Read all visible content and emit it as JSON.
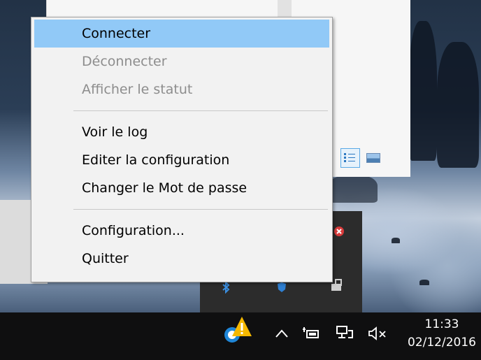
{
  "context_menu": {
    "groups": [
      [
        {
          "label": "Connecter",
          "state": "highlighted"
        },
        {
          "label": "Déconnecter",
          "state": "disabled"
        },
        {
          "label": "Afficher le statut",
          "state": "disabled"
        }
      ],
      [
        {
          "label": "Voir le log",
          "state": "enabled"
        },
        {
          "label": "Editer la configuration",
          "state": "enabled"
        },
        {
          "label": "Changer le Mot de passe",
          "state": "enabled"
        }
      ],
      [
        {
          "label": "Configuration...",
          "state": "enabled"
        },
        {
          "label": "Quitter",
          "state": "enabled"
        }
      ]
    ]
  },
  "explorer_view_buttons": [
    {
      "icon": "details-view-icon",
      "selected": true
    },
    {
      "icon": "preview-pane-icon",
      "selected": false
    }
  ],
  "tray_overflow_icons": [
    "red-x-badge-icon",
    "bluetooth-icon",
    "shield-app-icon",
    "network-lock-icon"
  ],
  "taskbar": {
    "icons": [
      "vpn-warning-icon",
      "chevron-up-icon",
      "battery-power-icon",
      "network-icon",
      "volume-muted-icon"
    ],
    "clock": {
      "time": "11:33",
      "date": "02/12/2016"
    }
  },
  "colors": {
    "menu_highlight": "#91c9f7",
    "menu_background": "#f2f2f2",
    "disabled_text": "#8d8d8d",
    "taskbar": "#0f0f10"
  }
}
